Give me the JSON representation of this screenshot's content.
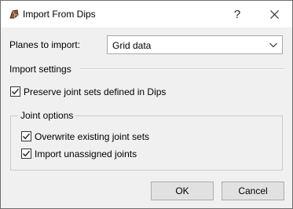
{
  "window": {
    "title": "Import From Dips",
    "help_label": "?"
  },
  "planes": {
    "label": "Planes to import:",
    "selected": "Grid data"
  },
  "import_settings": {
    "section_label": "Import settings",
    "preserve_label": "Preserve joint sets defined in Dips",
    "preserve_checked": true
  },
  "joint_options": {
    "group_label": "Joint options",
    "overwrite_label": "Overwrite existing joint sets",
    "overwrite_checked": true,
    "unassigned_label": "Import unassigned joints",
    "unassigned_checked": true
  },
  "buttons": {
    "ok": "OK",
    "cancel": "Cancel"
  }
}
